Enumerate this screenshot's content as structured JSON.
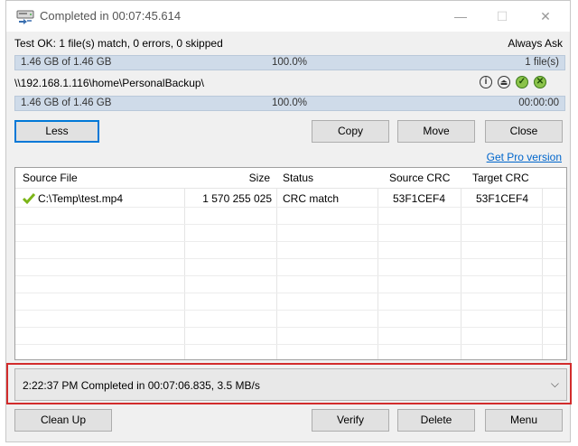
{
  "window": {
    "title": "Completed in 00:07:45.614",
    "minimize_glyph": "—",
    "maximize_glyph": "☐",
    "close_glyph": "✕"
  },
  "summary": {
    "status": "Test OK: 1 file(s) match, 0 errors, 0 skipped",
    "always_ask": "Always Ask"
  },
  "progress1": {
    "left": "1.46 GB of 1.46 GB",
    "percent": "100.0%",
    "right": "1 file(s)",
    "fill": 1.0
  },
  "destination": {
    "path": "\\\\192.168.1.116\\home\\PersonalBackup\\"
  },
  "progress2": {
    "left": "1.46 GB of 1.46 GB",
    "percent": "100.0%",
    "right": "00:00:00",
    "fill": 1.0
  },
  "actions": {
    "less": "Less",
    "copy": "Copy",
    "move": "Move",
    "close": "Close",
    "get_pro": "Get Pro version"
  },
  "table": {
    "columns": [
      "Source File",
      "Size",
      "Status",
      "Source CRC",
      "Target CRC"
    ],
    "rows": [
      {
        "file": "C:\\Temp\\test.mp4",
        "size": "1 570 255 025",
        "status": "CRC match",
        "source_crc": "53F1CEF4",
        "target_crc": "53F1CEF4"
      }
    ]
  },
  "log": {
    "selected": "2:22:37 PM Completed in 00:07:06.835, 3.5 MB/s"
  },
  "bottom_buttons": {
    "clean_up": "Clean Up",
    "verify": "Verify",
    "delete": "Delete",
    "menu": "Menu"
  },
  "icons": [
    "app-network-drive-icon",
    "info-icon",
    "eject-icon",
    "check-icon",
    "cancel-icon",
    "checkmark-icon",
    "chevron-down-icon"
  ],
  "colors": {
    "progress_fill": "#cfdbe9",
    "highlight_border": "#d22b2b",
    "focus_border": "#0078d7",
    "link": "#0066cc",
    "check_green": "#7cb518"
  }
}
